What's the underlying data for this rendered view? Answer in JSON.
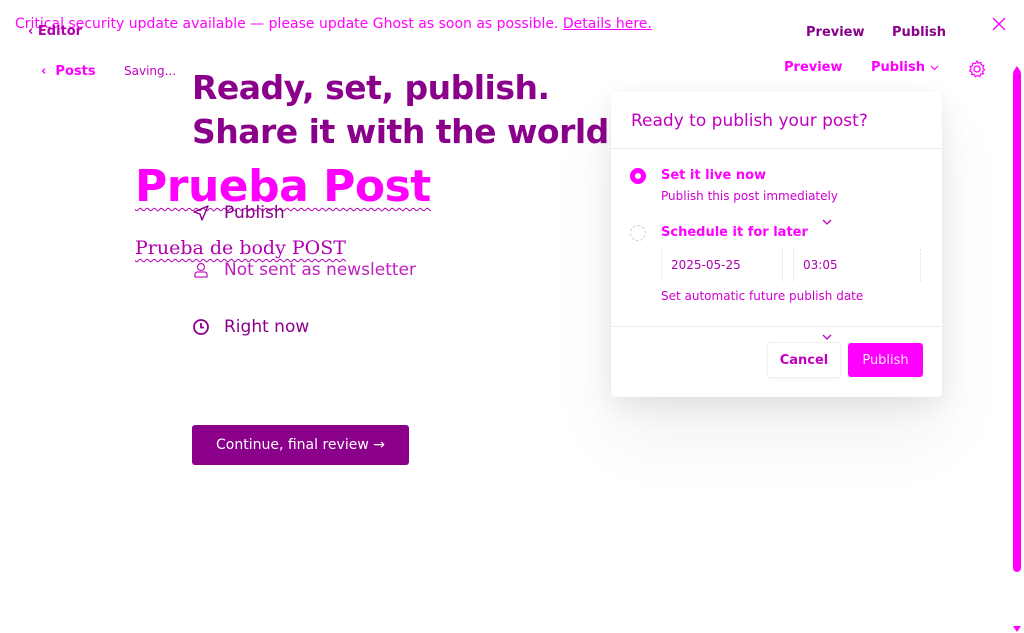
{
  "banner": {
    "text": "Critical security update available — please update Ghost as soon as possible.",
    "link": "Details here."
  },
  "editor_back": {
    "label": "Editor"
  },
  "publish_header": {
    "preview_label": "Preview",
    "publish_label": "Publish"
  },
  "editor_toolbar": {
    "posts_label": "Posts",
    "status_text": "Saving...",
    "preview_label": "Preview",
    "publish_label": "Publish"
  },
  "headline": {
    "line1": "Ready, set, publish.",
    "line2": "Share it with the world."
  },
  "post": {
    "title": "Prueba Post",
    "body": "Prueba de body POST"
  },
  "options": {
    "publish": "Publish",
    "newsletter": "Not sent as newsletter",
    "timing": "Right now"
  },
  "continue_button": "Continue, final review →",
  "popover": {
    "title": "Ready to publish your post?",
    "option_now": {
      "label": "Set it live now",
      "description": "Publish this post immediately"
    },
    "option_later": {
      "label": "Schedule it for later",
      "date": "2025-05-25",
      "time": "03:05",
      "description": "Set automatic future publish date"
    },
    "cancel_label": "Cancel",
    "publish_label": "Publish"
  },
  "colors": {
    "accent": "#ff00ff",
    "dark_accent": "#8b008b"
  },
  "icons": {
    "back": "chevron-left-icon",
    "close": "close-icon",
    "settings": "gear-icon",
    "publish": "send-icon",
    "newsletter": "user-icon",
    "timing": "clock-icon"
  }
}
